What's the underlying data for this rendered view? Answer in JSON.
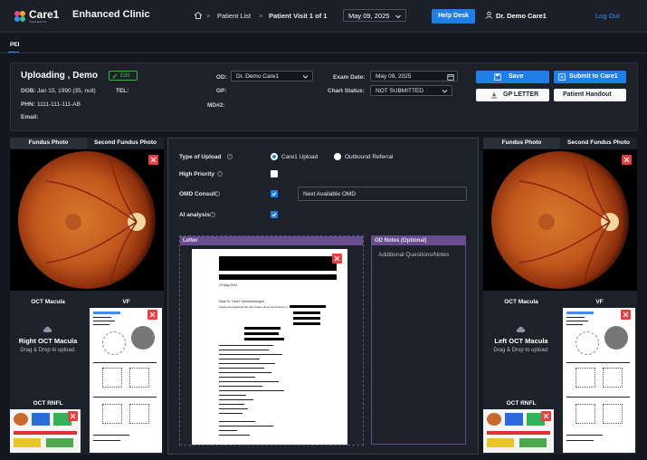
{
  "app": {
    "logo_text": "Care1",
    "logo_sub": "TELEHEALTH",
    "clinic_name": "Enhanced Clinic"
  },
  "breadcrumb": {
    "items": [
      "Patient List",
      "Patient Visit 1 of 1"
    ],
    "separator": ">"
  },
  "header": {
    "date_select": "May 09, 2025",
    "help_desk": "Help Desk",
    "user_name": "Dr. Demo Care1",
    "logout": "Log Out"
  },
  "tabs": {
    "active": "PEI"
  },
  "patient": {
    "name": "Uploading , Demo",
    "edit_label": "Edit",
    "dob_label": "DOB:",
    "dob_value": "Jan 15, 1990 (35, null)",
    "tel_label": "TEL:",
    "phn_label": "PHN:",
    "phn_value": "1111-111-111-AB",
    "email_label": "Email:"
  },
  "providers": {
    "od_label": "OD:",
    "od_value": "Dr. Demo Care1",
    "gp_label": "GP:",
    "md2_label": "MD#2:"
  },
  "exam": {
    "date_label": "Exam Date:",
    "date_value": "May 09, 2025",
    "status_label": "Chart Status:",
    "status_value": "NOT SUBMITTED"
  },
  "actions": {
    "save": "Save",
    "submit": "Submit to Care1",
    "gp_letter": "GP LETTER",
    "patient_handout": "Patient Handout"
  },
  "right_eye": {
    "tab_fundus": "Fundus Photo",
    "tab_second_fundus": "Second Fundus Photo",
    "oct_macula_head": "OCT Macula",
    "vf_head": "VF",
    "oct_drop_title": "Right OCT Macula",
    "oct_drop_sub": "Drag & Drop to upload.",
    "oct_rnfl_head": "OCT RNFL"
  },
  "left_eye": {
    "tab_fundus": "Fundus Photo",
    "tab_second_fundus": "Second Fundus Photo",
    "oct_macula_head": "OCT Macula",
    "vf_head": "VF",
    "oct_drop_title": "Left OCT Macula",
    "oct_drop_sub": "Drag & Drop to upload.",
    "oct_rnfl_head": "OCT RNFL"
  },
  "form": {
    "type_label": "Type of Upload",
    "type_options": [
      "Care1 Upload",
      "Outbound Referral"
    ],
    "type_selected": "Care1 Upload",
    "priority_label": "High Priority",
    "priority_checked": false,
    "omd_label": "OMD Consult",
    "omd_checked": true,
    "omd_value": "Next Available OMD",
    "ai_label": "AI analysis",
    "ai_checked": true,
    "help_glyph": "?"
  },
  "letter": {
    "head": "Letter",
    "date": "19 May 2023",
    "salutation": "Dear Dr. Care1 Ophthalmologist",
    "body_intro": "Please find attached the information about the findings of"
  },
  "notes": {
    "head": "OD Notes (Optional)",
    "placeholder": "Additional Questions/Notes"
  },
  "colors": {
    "accent": "#1f7ee8",
    "danger": "#e83e3e",
    "success": "#3fb045",
    "letter_purple": "#6a4d8e",
    "panel": "#1d2129",
    "background": "#14171d"
  },
  "icons": [
    "care1-logo-icon",
    "home-icon",
    "chevron-down-icon",
    "user-icon",
    "edit-icon",
    "calendar-icon",
    "save-icon",
    "submit-icon",
    "download-icon",
    "close-icon",
    "upload-cloud-icon",
    "help-icon"
  ]
}
